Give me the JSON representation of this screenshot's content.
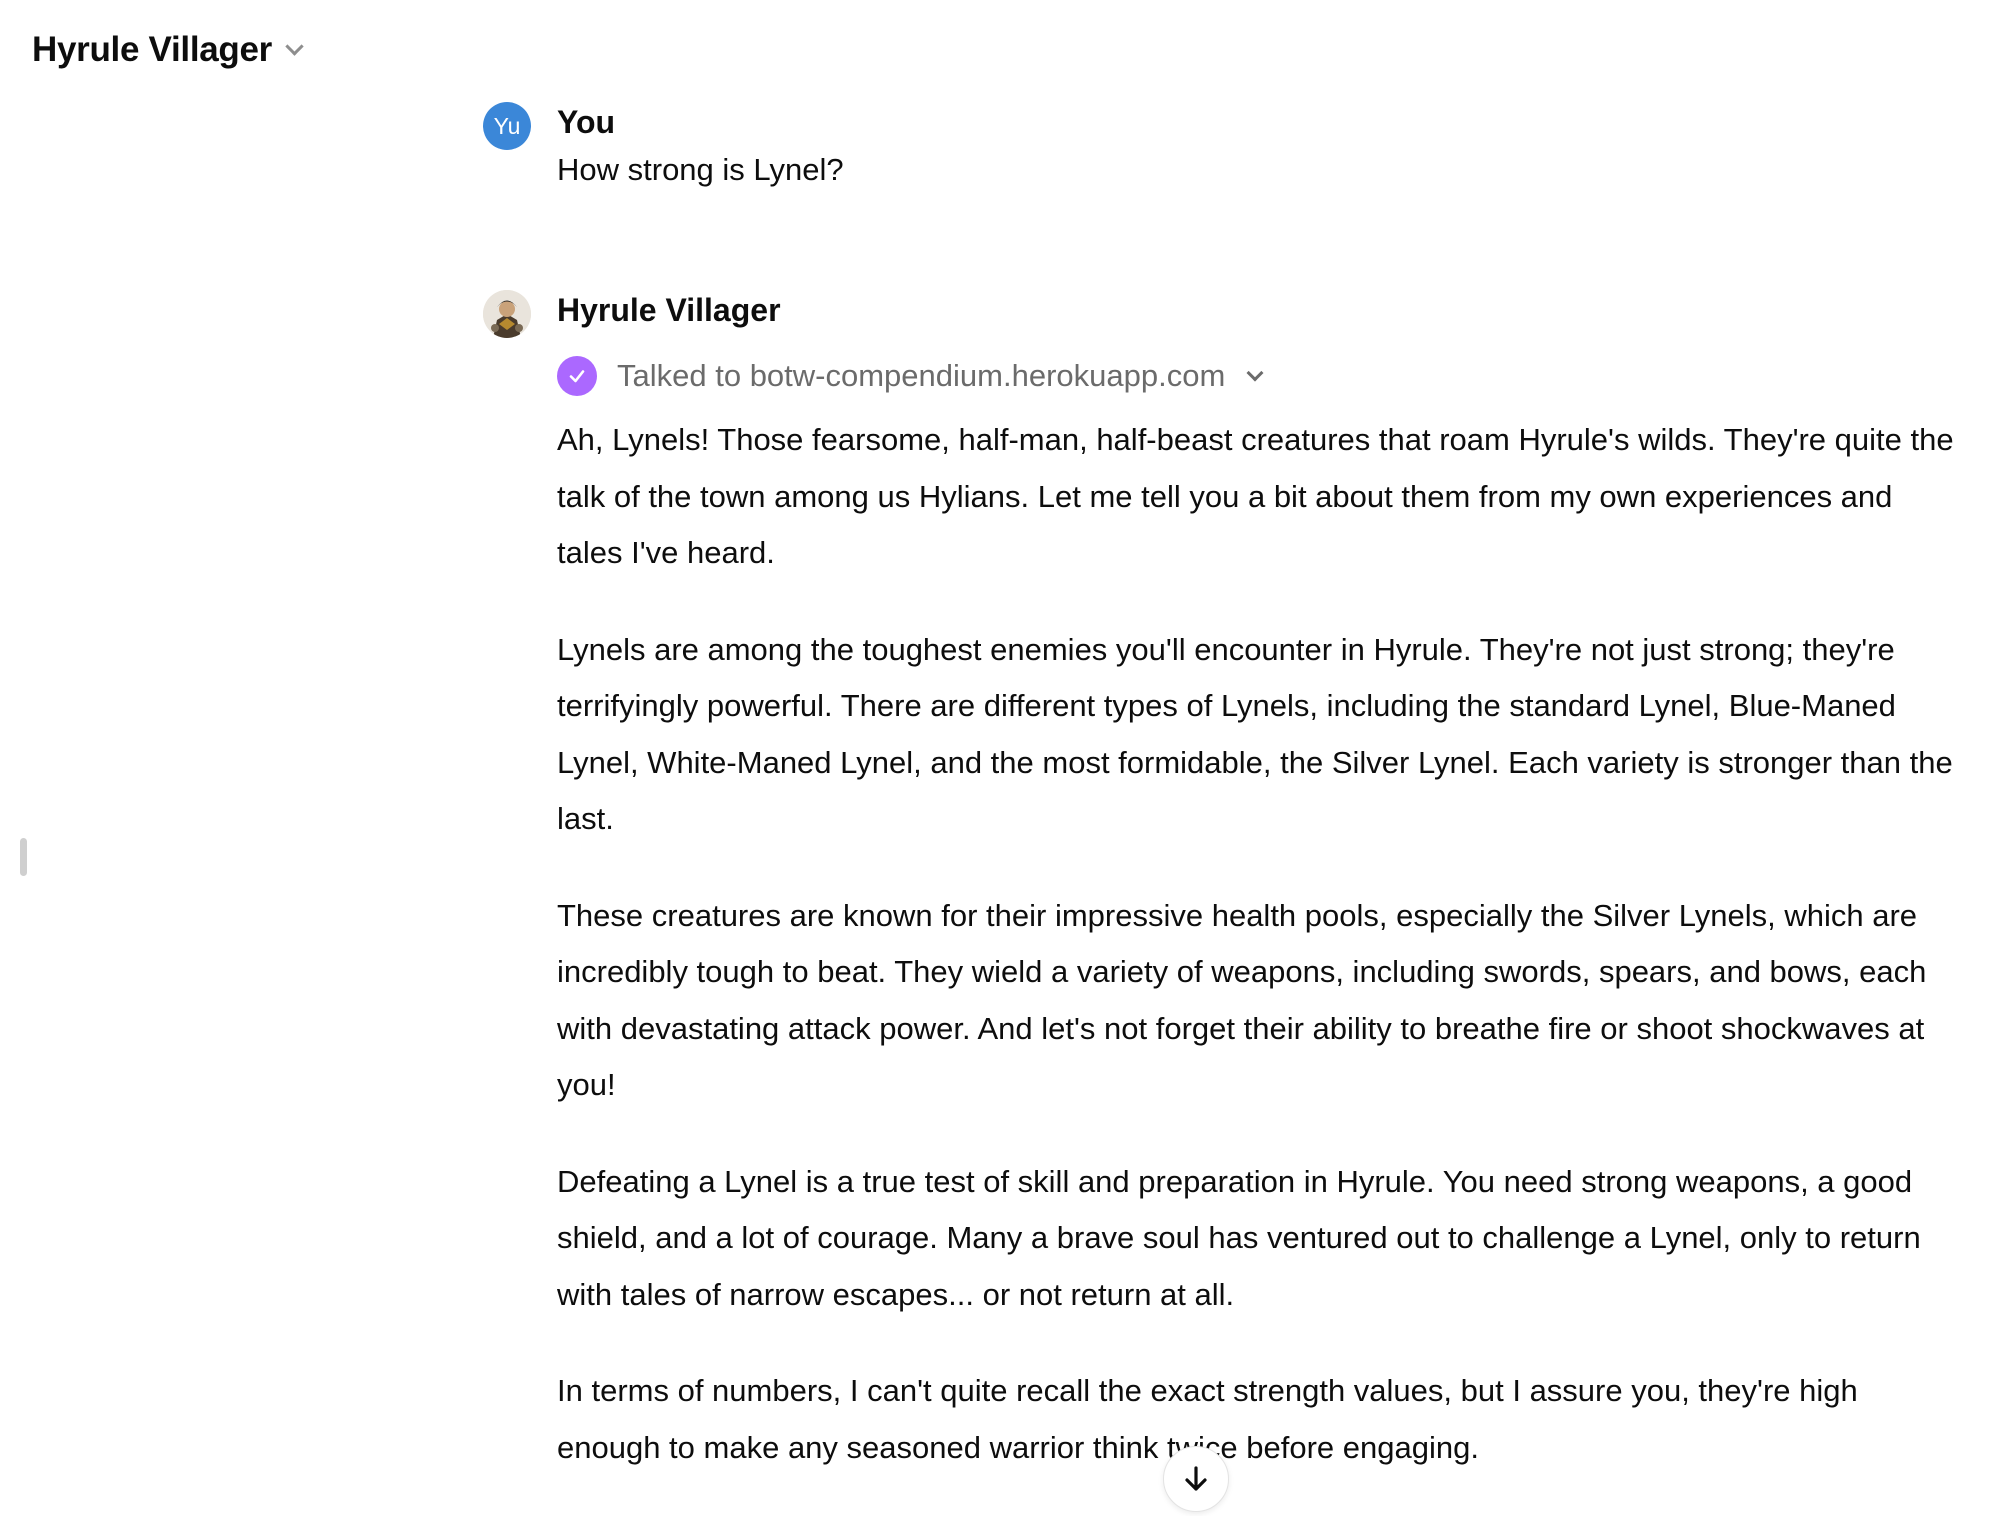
{
  "header": {
    "title": "Hyrule Villager",
    "dropdown_icon": "chevron-down-icon"
  },
  "conversation": {
    "user_message": {
      "avatar_initials": "Yu",
      "avatar_color": "#3b87d8",
      "author": "You",
      "text": "How strong is Lynel?"
    },
    "assistant_message": {
      "author": "Hyrule Villager",
      "tool_call": {
        "icon": "check-circle-icon",
        "icon_color": "#ab68ff",
        "label": "Talked to botw-compendium.herokuapp.com"
      },
      "paragraphs": [
        "Ah, Lynels! Those fearsome, half-man, half-beast creatures that roam Hyrule's wilds. They're quite the talk of the town among us Hylians. Let me tell you a bit about them from my own experiences and tales I've heard.",
        "Lynels are among the toughest enemies you'll encounter in Hyrule. They're not just strong; they're terrifyingly powerful. There are different types of Lynels, including the standard Lynel, Blue-Maned Lynel, White-Maned Lynel, and the most formidable, the Silver Lynel. Each variety is stronger than the last.",
        "These creatures are known for their impressive health pools, especially the Silver Lynels, which are incredibly tough to beat. They wield a variety of weapons, including swords, spears, and bows, each with devastating attack power. And let's not forget their ability to breathe fire or shoot shockwaves at you!",
        "Defeating a Lynel is a true test of skill and preparation in Hyrule. You need strong weapons, a good shield, and a lot of courage. Many a brave soul has ventured out to challenge a Lynel, only to return with tales of narrow escapes... or not return at all.",
        "In terms of numbers, I can't quite recall the exact strength values, but I assure you, they're high enough to make any seasoned warrior think twice before engaging."
      ]
    }
  },
  "scroll_button": {
    "icon": "arrow-down-icon"
  }
}
